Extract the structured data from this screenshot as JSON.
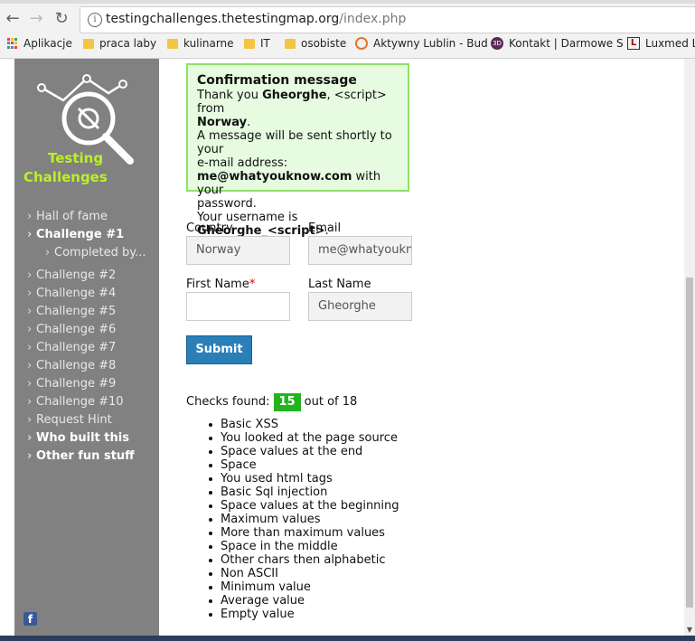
{
  "browser": {
    "url_host": "testingchallenges.thetestingmap.org",
    "url_path": "/index.php",
    "bookmarks": [
      {
        "label": "Aplikacje",
        "icon": "apps-icon"
      },
      {
        "label": "praca laby",
        "icon": "folder-icon"
      },
      {
        "label": "kulinarne",
        "icon": "folder-icon"
      },
      {
        "label": "IT",
        "icon": "folder-icon"
      },
      {
        "label": "osobiste",
        "icon": "folder-icon"
      },
      {
        "label": "Aktywny Lublin - Bud",
        "icon": "clock-icon"
      },
      {
        "label": "Kontakt | Darmowe S",
        "icon": "3d-icon"
      },
      {
        "label": "Luxmed Lu",
        "icon": "luxmed-icon"
      }
    ]
  },
  "sidebar": {
    "logo_line1": "Testing",
    "logo_line2": "Challenges",
    "menu": [
      {
        "label": "Hall of fame"
      },
      {
        "label": "Challenge #1"
      },
      {
        "label": "Completed by..."
      },
      {
        "label": "Challenge #2"
      },
      {
        "label": "Challenge #4"
      },
      {
        "label": "Challenge #5"
      },
      {
        "label": "Challenge #6"
      },
      {
        "label": "Challenge #7"
      },
      {
        "label": "Challenge #8"
      },
      {
        "label": "Challenge #9"
      },
      {
        "label": "Challenge #10"
      },
      {
        "label": "Request Hint"
      },
      {
        "label": "Who built this"
      },
      {
        "label": "Other fun stuff"
      }
    ],
    "facebook_icon": "f"
  },
  "confirmation": {
    "title": "Confirmation message",
    "l1_a": "Thank you ",
    "l1_name": "Gheorghe",
    "l1_b": ", <script> from",
    "l2_country": "Norway",
    "l2_end": ".",
    "l3": "A message will be sent shortly to your",
    "l4": "e-mail address:",
    "l5_email": "me@whatyouknow.com",
    "l5_b": " with your",
    "l6": "password.",
    "l7_a": "Your username is ",
    "l7_user": "Gheorghe_<script>",
    "l7_end": "."
  },
  "form": {
    "country_label": "Country",
    "country_value": "Norway",
    "email_label": "Email",
    "email_value": "me@whatyoukn",
    "first_name_label": "First Name",
    "first_name_required": "*",
    "first_name_value": "",
    "last_name_label": "Last Name",
    "last_name_value": "Gheorghe",
    "submit_label": "Submit"
  },
  "checks": {
    "prefix": "Checks found:",
    "found": "15",
    "suffix": "out of 18",
    "items": [
      "Basic XSS",
      "You looked at the page source",
      "Space values at the end",
      "Space",
      "You used html tags",
      "Basic Sql injection",
      "Space values at the beginning",
      "Maximum values",
      "More than maximum values",
      "Space in the middle",
      "Other chars then alphabetic",
      "Non ASCII",
      "Minimum value",
      "Average value",
      "Empty value"
    ]
  },
  "colors": {
    "sidebar_bg": "#818181",
    "logo_text": "#b9f126",
    "confirm_bg": "#e6fbe0",
    "confirm_border": "#8fe06a",
    "submit_bg": "#2a7fb8",
    "badge_bg": "#22b31f"
  }
}
